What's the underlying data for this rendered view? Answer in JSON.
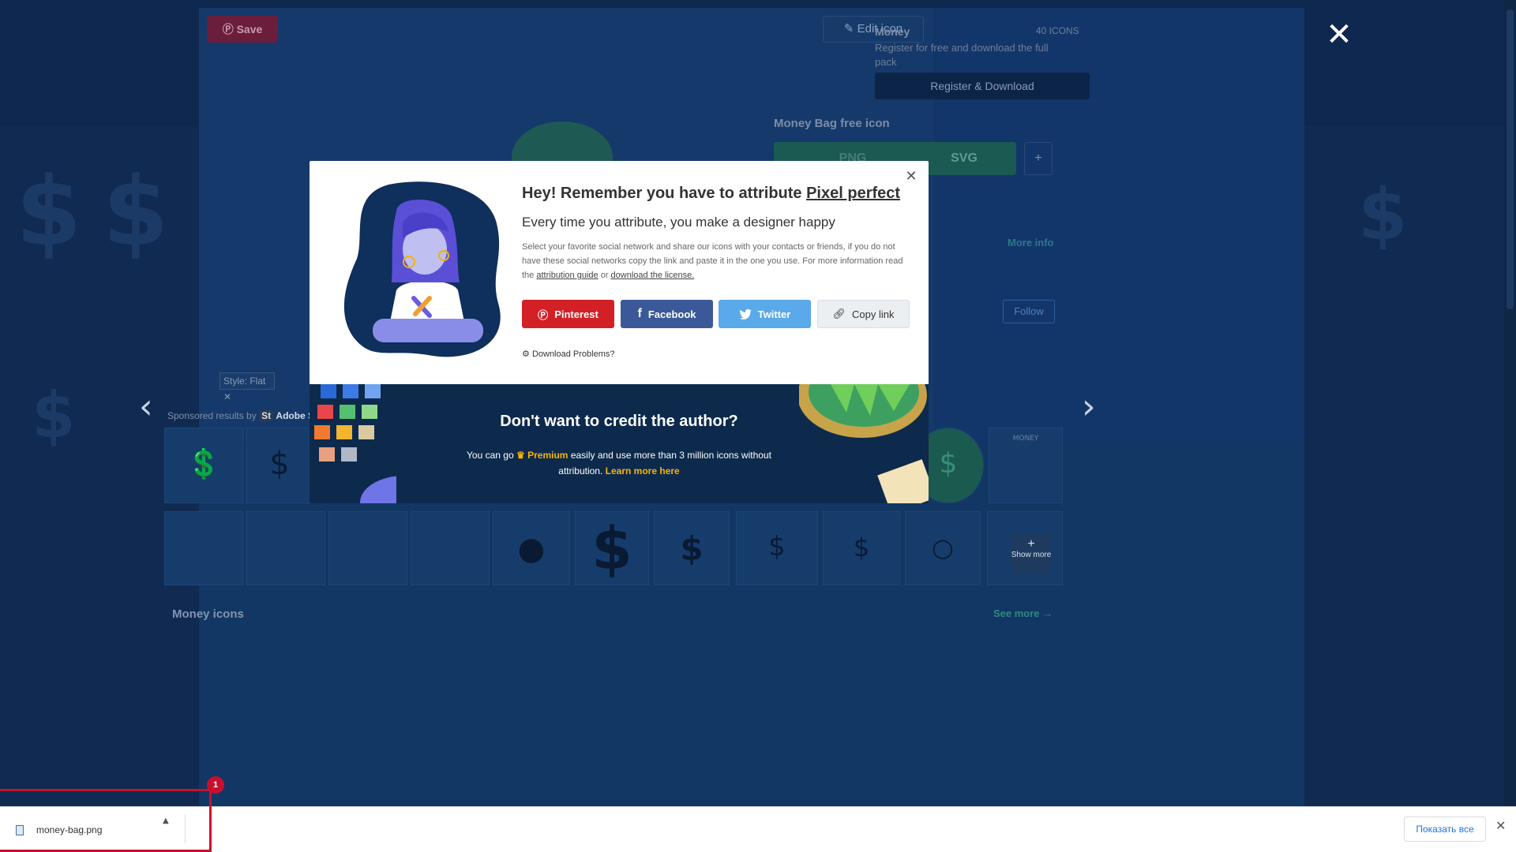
{
  "background": {
    "save_label": "Save",
    "edit_icon_label": "Edit icon",
    "pack": {
      "title": "Money",
      "count": "40 ICONS",
      "description": "Register for free and download the full pack",
      "register_label": "Register & Download"
    },
    "free_icon_title": "Money Bag free icon",
    "png_label": "PNG",
    "svg_label": "SVG",
    "plus_label": "+",
    "more_info": "More info",
    "follow_label": "Follow",
    "filter_chip": "Style: Flat",
    "sponsored": "Sponsored results by",
    "sponsor_name": "Adobe Stock",
    "money_icons_heading": "Money icons",
    "see_more": "See more",
    "show_more": "Show more"
  },
  "modal": {
    "heading_prefix": "Hey! Remember you have to attribute",
    "author": "Pixel perfect",
    "subheading": "Every time you attribute, you make a designer happy",
    "description_part1": "Select your favorite social network and share our icons with your contacts or friends, if you do not have these social networks copy the link and paste it in the one you use. For more information read the",
    "attribution_guide": "attribution guide",
    "or": "or",
    "download_license": "download the license.",
    "buttons": {
      "pinterest": "Pinterest",
      "facebook": "Facebook",
      "twitter": "Twitter",
      "copy_link": "Copy link"
    },
    "download_problems": "Download Problems?",
    "cta_title": "Don't want to credit the author?",
    "cta_text_1": "You can go",
    "cta_premium": "Premium",
    "cta_text_2": "easily and use more than 3 million icons without attribution.",
    "cta_learn_more": "Learn more here"
  },
  "download_bar": {
    "file_name": "money-bag.png",
    "badge_count": "1",
    "show_all": "Показать все"
  },
  "colors": {
    "pinterest": "#d32026",
    "facebook": "#3b5998",
    "twitter": "#5aa9ea",
    "premium": "#f7b500",
    "highlight": "#c8102e"
  }
}
